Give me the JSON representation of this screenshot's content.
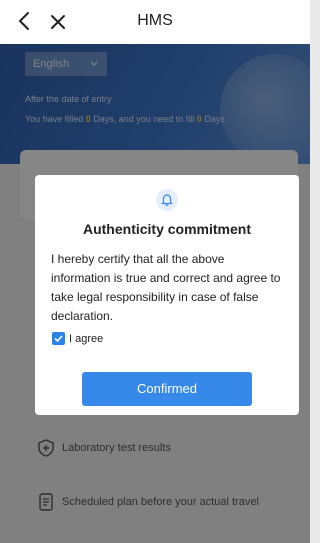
{
  "nav": {
    "title": "HMS"
  },
  "language": {
    "selected": "English"
  },
  "hero": {
    "line1": "After the date of entry",
    "line2_prefix": "You have filled ",
    "filled_days": "0",
    "line2_middle": " Days, and you need to fill ",
    "need_days": "0",
    "line2_suffix": " Days"
  },
  "list": {
    "lab_results": "Laboratory test results",
    "scheduled_plan": "Scheduled plan before your actual travel"
  },
  "modal": {
    "title": "Authenticity commitment",
    "body": "I hereby certify that all the above information is true and correct and agree to take legal responsibility in case of false declaration.",
    "agree_label": "I agree",
    "agree_checked": true,
    "confirm_label": "Confirmed"
  },
  "colors": {
    "accent": "#3789e9",
    "header": "#3a73c4",
    "highlight": "#f3c24e"
  },
  "icons": {
    "back": "chevron-left-icon",
    "close": "close-icon",
    "bell": "bell-icon",
    "check": "check-icon",
    "shield": "shield-plus-icon",
    "document": "document-icon",
    "dropdown": "chevron-down-icon"
  }
}
